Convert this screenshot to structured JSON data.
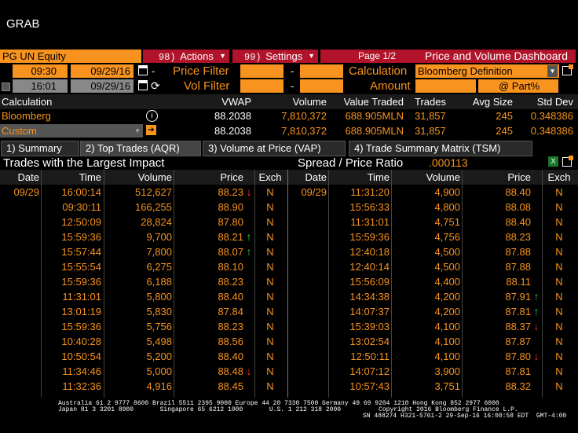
{
  "window": {
    "title": "GRAB"
  },
  "toolbar": {
    "ticker": "PG UN Equity",
    "actions_num": "98)",
    "actions_label": "Actions",
    "settings_num": "99)",
    "settings_label": "Settings",
    "page": "Page 1/2",
    "dashboard": "Price and Volume Dashboard"
  },
  "filters": {
    "start_time": "09:30",
    "start_date": "09/29/16",
    "end_time": "16:01",
    "end_date": "09/29/16",
    "price_filter_label": "Price Filter",
    "vol_filter_label": "Vol Filter",
    "dash": "-",
    "calculation_label": "Calculation",
    "calculation_value": "Bloomberg Definition",
    "amount_label": "Amount",
    "amount_value": "@ Part%"
  },
  "summary": {
    "headers": [
      "Calculation",
      "VWAP",
      "Volume",
      "Value Traded",
      "Trades",
      "Avg Size",
      "Std Dev"
    ],
    "rows": [
      [
        "Bloomberg",
        "88.2038",
        "7,810,372",
        "688.905MLN",
        "31,857",
        "245",
        "0.348386"
      ],
      [
        "Custom",
        "88.2038",
        "7,810,372",
        "688.905MLN",
        "31,857",
        "245",
        "0.348386"
      ]
    ]
  },
  "tabs": [
    {
      "label": "1) Summary"
    },
    {
      "label": "2) Top Trades (AQR)"
    },
    {
      "label": "3) Volume at Price (VAP)"
    },
    {
      "label": "4) Trade Summary Matrix (TSM)"
    }
  ],
  "section": {
    "title": "Trades with the Largest Impact",
    "ratio_label": "Spread / Price Ratio",
    "ratio_value": ".000113"
  },
  "table": {
    "headers": [
      "Date",
      "Time",
      "Volume",
      "Price",
      "Exch"
    ],
    "left": [
      {
        "date": "09/29",
        "time": "16:00:14",
        "volume": "512,627",
        "price": "88.23",
        "arrow": "↓",
        "dir": "down",
        "exch": "N"
      },
      {
        "date": "",
        "time": "09:30:11",
        "volume": "166,255",
        "price": "88.90",
        "arrow": "",
        "dir": "",
        "exch": "N"
      },
      {
        "date": "",
        "time": "12:50:09",
        "volume": "28,824",
        "price": "87.80",
        "arrow": "",
        "dir": "",
        "exch": "N"
      },
      {
        "date": "",
        "time": "15:59:36",
        "volume": "9,700",
        "price": "88.21",
        "arrow": "↑",
        "dir": "up",
        "exch": "N"
      },
      {
        "date": "",
        "time": "15:57:44",
        "volume": "7,800",
        "price": "88.07",
        "arrow": "↑",
        "dir": "up",
        "exch": "N"
      },
      {
        "date": "",
        "time": "15:55:54",
        "volume": "6,275",
        "price": "88.10",
        "arrow": "",
        "dir": "",
        "exch": "N"
      },
      {
        "date": "",
        "time": "15:59:36",
        "volume": "6,188",
        "price": "88.23",
        "arrow": "",
        "dir": "",
        "exch": "N"
      },
      {
        "date": "",
        "time": "11:31:01",
        "volume": "5,800",
        "price": "88.40",
        "arrow": "",
        "dir": "",
        "exch": "N"
      },
      {
        "date": "",
        "time": "13:01:19",
        "volume": "5,830",
        "price": "87.84",
        "arrow": "",
        "dir": "",
        "exch": "N"
      },
      {
        "date": "",
        "time": "15:59:36",
        "volume": "5,756",
        "price": "88.23",
        "arrow": "",
        "dir": "",
        "exch": "N"
      },
      {
        "date": "",
        "time": "10:40:28",
        "volume": "5,498",
        "price": "88.56",
        "arrow": "",
        "dir": "",
        "exch": "N"
      },
      {
        "date": "",
        "time": "10:50:54",
        "volume": "5,200",
        "price": "88.40",
        "arrow": "",
        "dir": "",
        "exch": "N"
      },
      {
        "date": "",
        "time": "11:34:46",
        "volume": "5,000",
        "price": "88.48",
        "arrow": "↓",
        "dir": "down",
        "exch": "N"
      },
      {
        "date": "",
        "time": "11:32:36",
        "volume": "4,916",
        "price": "88.45",
        "arrow": "",
        "dir": "",
        "exch": "N"
      }
    ],
    "right": [
      {
        "date": "09/29",
        "time": "11:31:20",
        "volume": "4,900",
        "price": "88.40",
        "arrow": "",
        "dir": "",
        "exch": "N"
      },
      {
        "date": "",
        "time": "15:56:33",
        "volume": "4,800",
        "price": "88.08",
        "arrow": "",
        "dir": "",
        "exch": "N"
      },
      {
        "date": "",
        "time": "11:31:01",
        "volume": "4,751",
        "price": "88.40",
        "arrow": "",
        "dir": "",
        "exch": "N"
      },
      {
        "date": "",
        "time": "15:59:36",
        "volume": "4,756",
        "price": "88.23",
        "arrow": "",
        "dir": "",
        "exch": "N"
      },
      {
        "date": "",
        "time": "12:40:18",
        "volume": "4,500",
        "price": "87.88",
        "arrow": "",
        "dir": "",
        "exch": "N"
      },
      {
        "date": "",
        "time": "12:40:14",
        "volume": "4,500",
        "price": "87.88",
        "arrow": "",
        "dir": "",
        "exch": "N"
      },
      {
        "date": "",
        "time": "15:56:09",
        "volume": "4,400",
        "price": "88.11",
        "arrow": "",
        "dir": "",
        "exch": "N"
      },
      {
        "date": "",
        "time": "14:34:38",
        "volume": "4,200",
        "price": "87.91",
        "arrow": "↑",
        "dir": "up",
        "exch": "N"
      },
      {
        "date": "",
        "time": "14:07:37",
        "volume": "4,200",
        "price": "87.81",
        "arrow": "↑",
        "dir": "up",
        "exch": "N"
      },
      {
        "date": "",
        "time": "15:39:03",
        "volume": "4,100",
        "price": "88.37",
        "arrow": "↓",
        "dir": "down",
        "exch": "N"
      },
      {
        "date": "",
        "time": "13:02:54",
        "volume": "4,100",
        "price": "87.87",
        "arrow": "",
        "dir": "",
        "exch": "N"
      },
      {
        "date": "",
        "time": "12:50:11",
        "volume": "4,100",
        "price": "87.80",
        "arrow": "↓",
        "dir": "down",
        "exch": "N"
      },
      {
        "date": "",
        "time": "14:07:12",
        "volume": "3,900",
        "price": "87.81",
        "arrow": "",
        "dir": "",
        "exch": "N"
      },
      {
        "date": "",
        "time": "10:57:43",
        "volume": "3,751",
        "price": "88.32",
        "arrow": "",
        "dir": "",
        "exch": "N"
      }
    ]
  },
  "footer": {
    "line1": "Australia 61 2 9777 8600 Brazil 5511 2395 9000 Europe 44 20 7330 7500 Germany 49 69 9204 1210 Hong Kong 852 2977 6000",
    "line2": "Japan 81 3 3201 8900       Singapore 65 6212 1000       U.S. 1 212 318 2000          Copyright 2016 Bloomberg Finance L.P.",
    "line3": "SN 488274 H321-5761-2 29-Sep-16 16:00:58 EDT  GMT-4:00"
  },
  "colors": {
    "amber": "#f7931e",
    "red": "#b0132a",
    "up": "#2ecc40",
    "down": "#ff3030"
  }
}
